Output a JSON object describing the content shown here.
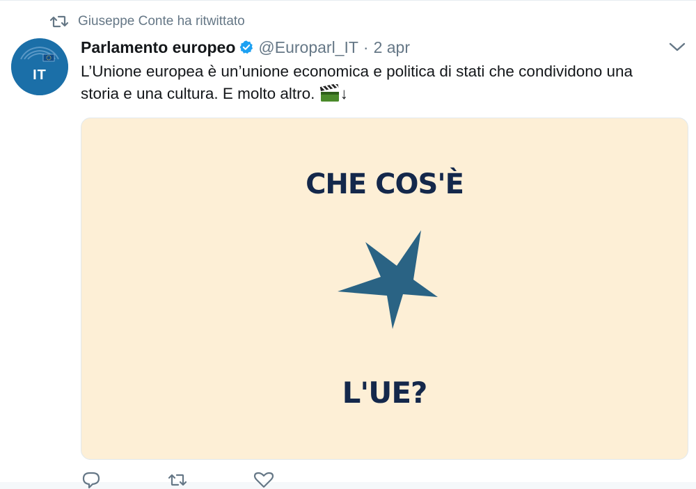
{
  "retweet_context": {
    "icon": "retweet-icon",
    "text": "Giuseppe Conte ha ritwittato"
  },
  "tweet": {
    "avatar": {
      "label": "IT",
      "color": "#1b6fa8"
    },
    "author": {
      "fullname": "Parlamento europeo",
      "verified": true,
      "username": "@Europarl_IT",
      "separator": "·",
      "timestamp": "2 apr"
    },
    "text_line1": "L’Unione europea è un’unione economica e politica di stati che condividono una",
    "text_line2": "storia e una cultura. E molto altro.",
    "text_suffix": "↓",
    "media": {
      "title": "CHE COS'È",
      "subtitle": "L'UE?",
      "background": "#fdefd6",
      "star_color": "#2a6384",
      "text_color": "#14284b"
    },
    "actions": {
      "reply_count": "",
      "retweet_count": "",
      "like_count": ""
    }
  },
  "colors": {
    "secondary_text": "#657786",
    "verified_blue": "#1da1f2"
  }
}
